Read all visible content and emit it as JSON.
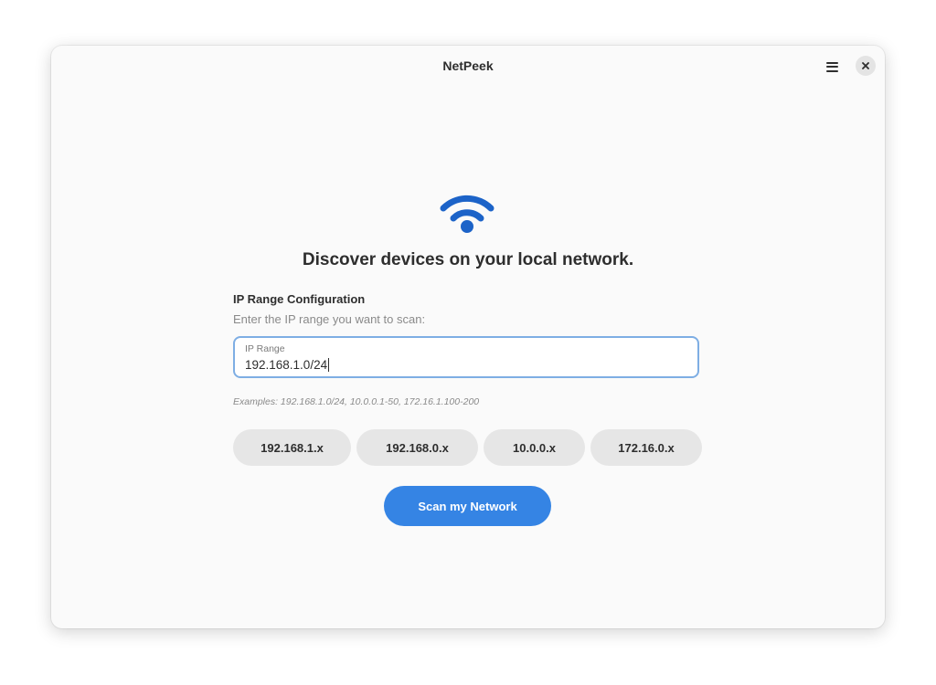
{
  "window": {
    "title": "NetPeek"
  },
  "header": {
    "menu_icon": "hamburger-menu-icon",
    "close_icon": "close-icon"
  },
  "hero": {
    "icon": "wifi-icon",
    "headline": "Discover devices on your local network."
  },
  "config": {
    "title": "IP Range Configuration",
    "subtitle": "Enter the IP range you want to scan:",
    "input": {
      "label": "IP Range",
      "value": "192.168.1.0/24"
    },
    "examples": "Examples: 192.168.1.0/24, 10.0.0.1-50, 172.16.1.100-200"
  },
  "presets": [
    {
      "label": "192.168.1.x"
    },
    {
      "label": "192.168.0.x"
    },
    {
      "label": "10.0.0.x"
    },
    {
      "label": "172.16.0.x"
    }
  ],
  "actions": {
    "scan_label": "Scan my Network"
  },
  "colors": {
    "accent": "#3584e4",
    "wifi_icon": "#1c63c8",
    "input_focus_border": "#7eaee4",
    "chip_bg": "#e6e6e6",
    "window_bg": "#fafafa"
  }
}
